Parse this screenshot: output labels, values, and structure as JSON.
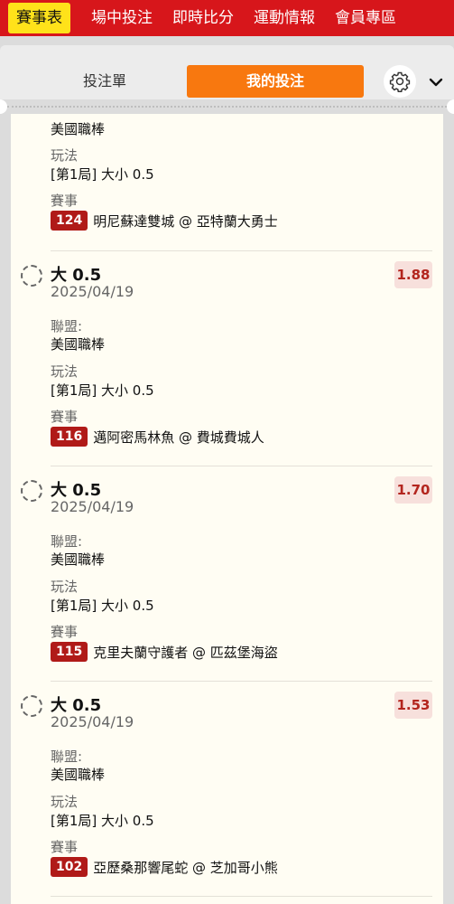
{
  "topnav": {
    "tabs": [
      {
        "label": "賽事表"
      },
      {
        "label": "場中投注"
      },
      {
        "label": "即時比分"
      },
      {
        "label": "運動情報"
      },
      {
        "label": "會員專區"
      }
    ]
  },
  "slip": {
    "tab_betslip": "投注單",
    "tab_mybets": "我的投注"
  },
  "partial_card": {
    "league": "美國職棒",
    "play_label": "玩法",
    "play": "[第1局] 大小 0.5",
    "match_label": "賽事",
    "match_no": "124",
    "match": "明尼蘇達雙城 @ 亞特蘭大勇士"
  },
  "bets": [
    {
      "selection": "大 0.5",
      "date": "2025/04/19",
      "odds": "1.88",
      "league_label": "聯盟:",
      "league": "美國職棒",
      "play_label": "玩法",
      "play": "[第1局] 大小 0.5",
      "match_label": "賽事",
      "match_no": "116",
      "match": "邁阿密馬林魚 @ 費城費城人"
    },
    {
      "selection": "大 0.5",
      "date": "2025/04/19",
      "odds": "1.70",
      "league_label": "聯盟:",
      "league": "美國職棒",
      "play_label": "玩法",
      "play": "[第1局] 大小 0.5",
      "match_label": "賽事",
      "match_no": "115",
      "match": "克里夫蘭守護者 @ 匹茲堡海盜"
    },
    {
      "selection": "大 0.5",
      "date": "2025/04/19",
      "odds": "1.53",
      "league_label": "聯盟:",
      "league": "美國職棒",
      "play_label": "玩法",
      "play": "[第1局] 大小 0.5",
      "match_label": "賽事",
      "match_no": "102",
      "match": "亞歷桑那響尾蛇 @ 芝加哥小熊"
    }
  ],
  "colors": {
    "nav_bg": "#d7161b",
    "nav_active": "#ffe21a",
    "tab_active": "#f8780f",
    "odds_text": "#b3261e",
    "match_badge": "#b01a18"
  }
}
